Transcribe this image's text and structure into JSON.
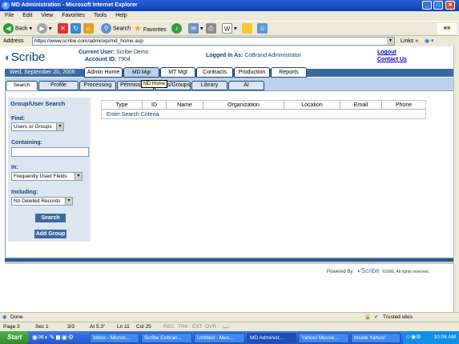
{
  "window": {
    "title": "MD Administration - Microsoft Internet Explorer",
    "min": "_",
    "max": "□",
    "close": "✕"
  },
  "menu": [
    "File",
    "Edit",
    "View",
    "Favorites",
    "Tools",
    "Help"
  ],
  "toolbar": {
    "back": "Back",
    "search": "Search",
    "favorites": "Favorites"
  },
  "address": {
    "label": "Address",
    "url": "https://www.scribe.com/adminxp/md_home.asp",
    "links": "Links"
  },
  "header": {
    "logo": "Scribe",
    "current_user_label": "Current User:",
    "current_user": "Scribe Demo",
    "account_label": "Account ID:",
    "account_id": "7904",
    "logged_in_label": "Logged In As:",
    "logged_in": "CoBrand Administrator",
    "logout": "Logout",
    "contact": "Contact Us",
    "date": "Wed, September 20, 2006"
  },
  "top_tabs": [
    "Admin Home",
    "MD Mgt",
    "MT Mgt",
    "Contracts",
    "Production",
    "Reports"
  ],
  "sub_tabs": [
    "Search",
    "Profile",
    "Processing",
    "Permissions",
    "Users/Groups",
    "Library",
    "AI"
  ],
  "tooltip": "MD Home",
  "search_panel": {
    "title": "Group/User Search",
    "find_label": "Find:",
    "find_value": "Users or Groups",
    "containing_label": "Containing:",
    "containing_value": "",
    "in_label": "In:",
    "in_value": "Frequently Used Fields",
    "including_label": "Including:",
    "including_value": "No Deleted Records",
    "search_button": "Search",
    "add_group_button": "Add Group"
  },
  "results": {
    "columns": [
      "Type",
      "ID",
      "Name",
      "Organization",
      "Location",
      "Email",
      "Phone"
    ],
    "message": "Enter Search Criteria"
  },
  "footer": {
    "powered_by": "Powered By",
    "logo": "Scribe",
    "copyright": "©2006. All rights reserved."
  },
  "status": {
    "text": "Done",
    "zone": "Trusted sites"
  },
  "word_status": {
    "page": "Page 3",
    "sec": "Sec 1",
    "pages": "3/3",
    "at": "At 5.3\"",
    "ln": "Ln 11",
    "col": "Col 25",
    "rec": "REC",
    "trk": "TRK",
    "ext": "EXT",
    "ovr": "OVR"
  },
  "taskbar": {
    "start": "Start",
    "tasks": [
      "Inbox - Micros...",
      "Scribe Cobran...",
      "Untitled - Mes...",
      "MD Administ...",
      "Yahoo! Messe...",
      "Inside Yahoo!"
    ],
    "clock": "10:08 AM"
  }
}
